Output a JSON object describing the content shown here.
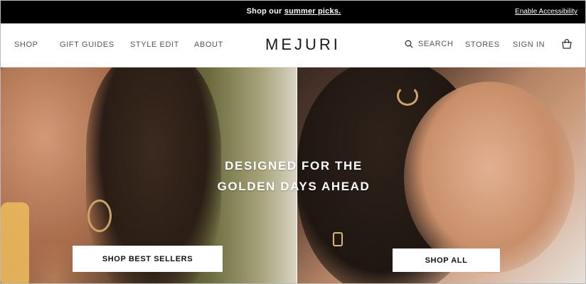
{
  "announcement": {
    "prefix": "Shop our",
    "link": "summer picks.",
    "accessibility": "Enable Accessibility"
  },
  "nav": {
    "left_items": [
      "SHOP",
      "GIFT GUIDES",
      "STYLE EDIT",
      "ABOUT"
    ],
    "logo": "MEJURI",
    "search": "SEARCH",
    "stores": "STORES",
    "sign_in": "SIGN IN"
  },
  "hero": {
    "headline_line1": "DESIGNED FOR THE",
    "headline_line2": "GOLDEN DAYS AHEAD",
    "cta_left": "SHOP BEST SELLERS",
    "cta_right": "SHOP ALL"
  },
  "icons": {
    "search": "search-icon",
    "cart": "shopping-bag-icon"
  },
  "colors": {
    "announcement_bg": "#000000",
    "text_dark": "#1a1a1a",
    "nav_text": "#555555",
    "button_bg": "#ffffff"
  }
}
